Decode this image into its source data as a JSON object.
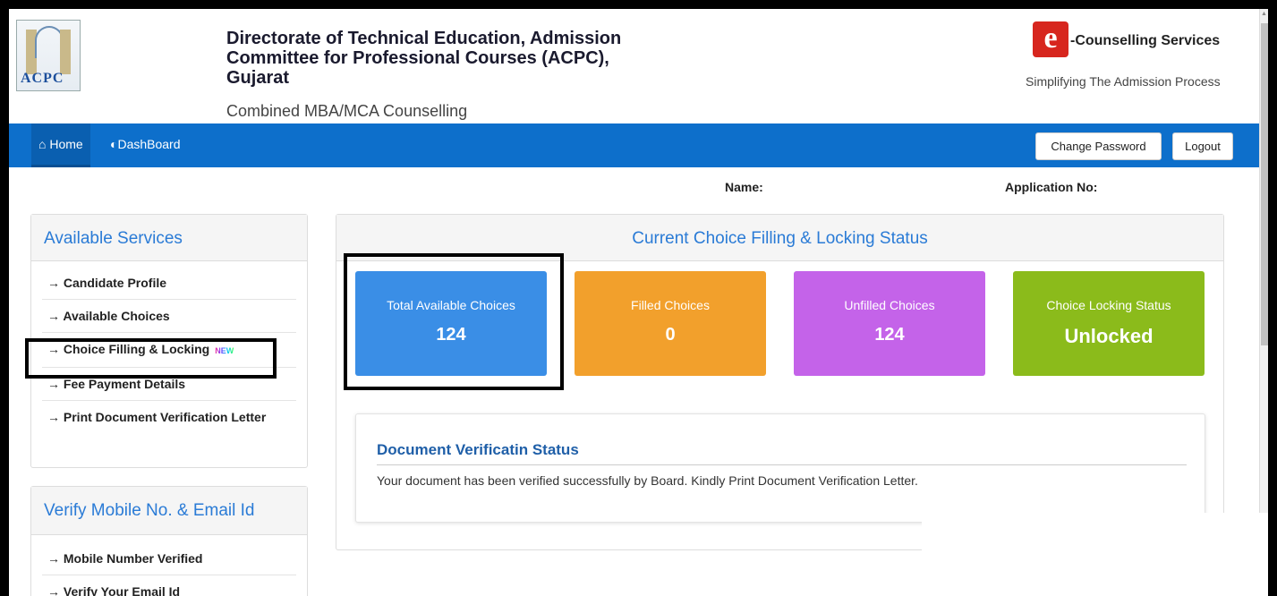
{
  "header": {
    "title_line1": "Directorate of Technical Education, Admission",
    "title_line2": "Committee for Professional Courses (ACPC),",
    "title_line3": "Gujarat",
    "subtitle": "Combined MBA/MCA Counselling",
    "logo_text": "ACPC",
    "brand_title": "-Counselling Services",
    "brand_tagline": "Simplifying The Admission Process",
    "brand_logo_letter": "e"
  },
  "nav": {
    "home_label": "Home",
    "dashboard_label": "DashBoard",
    "change_password_label": "Change Password",
    "logout_label": "Logout"
  },
  "info": {
    "name_label": "Name:",
    "application_label": "Application No:"
  },
  "services": {
    "heading": "Available Services",
    "items": [
      {
        "label": "Candidate Profile"
      },
      {
        "label": "Available Choices"
      },
      {
        "label": "Choice Filling & Locking",
        "badge": "NEW"
      },
      {
        "label": "Fee Payment Details"
      },
      {
        "label": "Print Document Verification Letter"
      }
    ]
  },
  "verify": {
    "heading": "Verify Mobile No. & Email Id",
    "items": [
      {
        "label": "Mobile Number Verified"
      },
      {
        "label": "Verify Your Email Id"
      }
    ]
  },
  "status": {
    "heading": "Current Choice Filling & Locking Status",
    "cards": [
      {
        "label": "Total Available Choices",
        "value": "124",
        "color": "#3a8ee6"
      },
      {
        "label": "Filled Choices",
        "value": "0",
        "color": "#f2a02c"
      },
      {
        "label": "Unfilled Choices",
        "value": "124",
        "color": "#c463e9"
      },
      {
        "label": "Choice Locking Status",
        "value": "Unlocked",
        "color": "#8bbb1b"
      }
    ]
  },
  "document": {
    "title": "Document Verificatin Status",
    "message": "Your document has been verified successfully by Board. Kindly Print Document Verification Letter."
  },
  "colors": {
    "navbar": "#0d6fcb",
    "heading_blue": "#2a7bd6"
  }
}
